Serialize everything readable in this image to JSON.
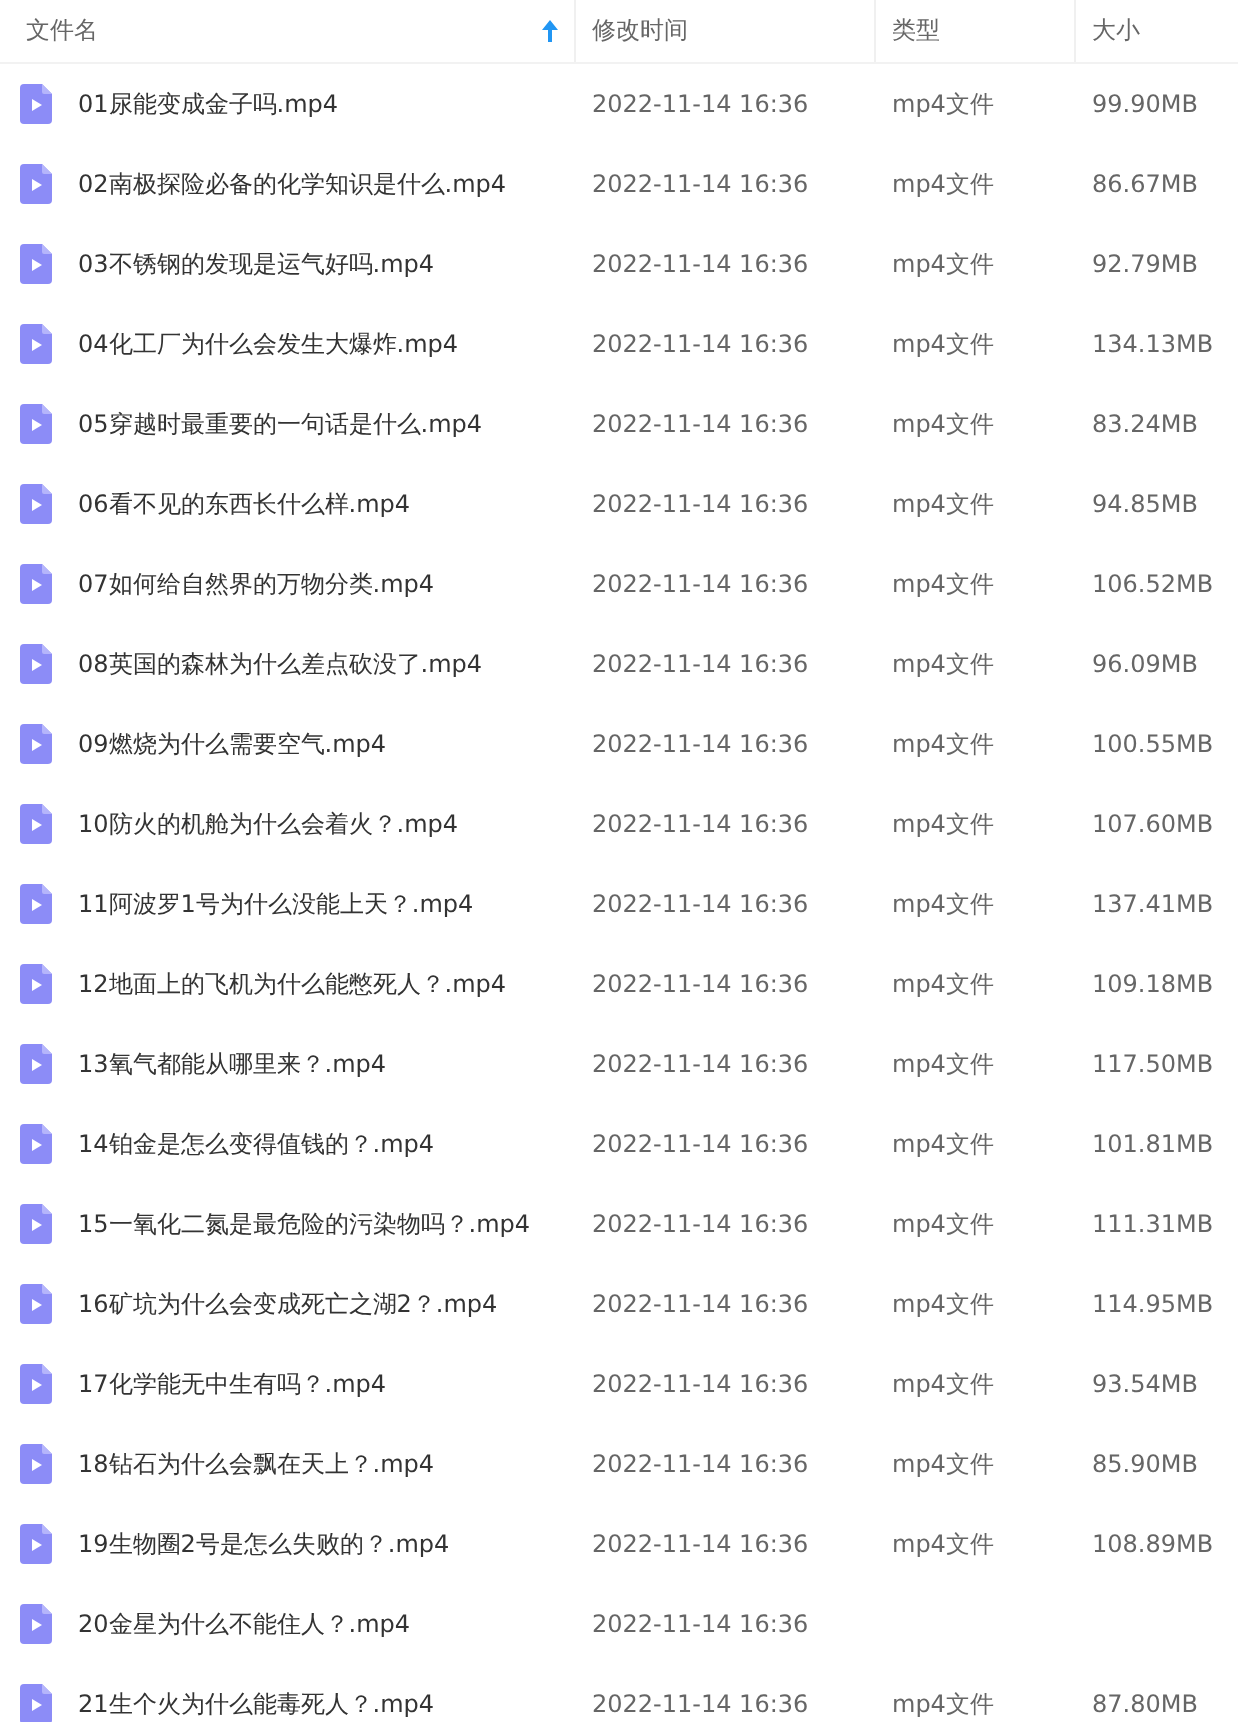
{
  "columns": [
    {
      "label": "文件名",
      "sorted": true
    },
    {
      "label": "修改时间",
      "sorted": false
    },
    {
      "label": "类型",
      "sorted": false
    },
    {
      "label": "大小",
      "sorted": false
    }
  ],
  "rows": [
    {
      "name": "01尿能变成金子吗.mp4",
      "modified": "2022-11-14 16:36",
      "type": "mp4文件",
      "size": "99.90MB"
    },
    {
      "name": "02南极探险必备的化学知识是什么.mp4",
      "modified": "2022-11-14 16:36",
      "type": "mp4文件",
      "size": "86.67MB"
    },
    {
      "name": "03不锈钢的发现是运气好吗.mp4",
      "modified": "2022-11-14 16:36",
      "type": "mp4文件",
      "size": "92.79MB"
    },
    {
      "name": "04化工厂为什么会发生大爆炸.mp4",
      "modified": "2022-11-14 16:36",
      "type": "mp4文件",
      "size": "134.13MB"
    },
    {
      "name": "05穿越时最重要的一句话是什么.mp4",
      "modified": "2022-11-14 16:36",
      "type": "mp4文件",
      "size": "83.24MB"
    },
    {
      "name": "06看不见的东西长什么样.mp4",
      "modified": "2022-11-14 16:36",
      "type": "mp4文件",
      "size": "94.85MB"
    },
    {
      "name": "07如何给自然界的万物分类.mp4",
      "modified": "2022-11-14 16:36",
      "type": "mp4文件",
      "size": "106.52MB"
    },
    {
      "name": "08英国的森林为什么差点砍没了.mp4",
      "modified": "2022-11-14 16:36",
      "type": "mp4文件",
      "size": "96.09MB"
    },
    {
      "name": "09燃烧为什么需要空气.mp4",
      "modified": "2022-11-14 16:36",
      "type": "mp4文件",
      "size": "100.55MB"
    },
    {
      "name": "10防火的机舱为什么会着火？.mp4",
      "modified": "2022-11-14 16:36",
      "type": "mp4文件",
      "size": "107.60MB"
    },
    {
      "name": "11阿波罗1号为什么没能上天？.mp4",
      "modified": "2022-11-14 16:36",
      "type": "mp4文件",
      "size": "137.41MB"
    },
    {
      "name": "12地面上的飞机为什么能憋死人？.mp4",
      "modified": "2022-11-14 16:36",
      "type": "mp4文件",
      "size": "109.18MB"
    },
    {
      "name": "13氧气都能从哪里来？.mp4",
      "modified": "2022-11-14 16:36",
      "type": "mp4文件",
      "size": "117.50MB"
    },
    {
      "name": "14铂金是怎么变得值钱的？.mp4",
      "modified": "2022-11-14 16:36",
      "type": "mp4文件",
      "size": "101.81MB"
    },
    {
      "name": "15一氧化二氮是最危险的污染物吗？.mp4",
      "modified": "2022-11-14 16:36",
      "type": "mp4文件",
      "size": "111.31MB"
    },
    {
      "name": "16矿坑为什么会变成死亡之湖2？.mp4",
      "modified": "2022-11-14 16:36",
      "type": "mp4文件",
      "size": "114.95MB"
    },
    {
      "name": "17化学能无中生有吗？.mp4",
      "modified": "2022-11-14 16:36",
      "type": "mp4文件",
      "size": "93.54MB"
    },
    {
      "name": "18钻石为什么会飘在天上？.mp4",
      "modified": "2022-11-14 16:36",
      "type": "mp4文件",
      "size": "85.90MB"
    },
    {
      "name": "19生物圈2号是怎么失败的？.mp4",
      "modified": "2022-11-14 16:36",
      "type": "mp4文件",
      "size": "108.89MB"
    },
    {
      "name": "20金星为什么不能住人？.mp4",
      "modified": "2022-11-14 16:36"
    },
    {
      "name": "21生个火为什么能毒死人？.mp4",
      "modified": "2022-11-14 16:36",
      "type": "mp4文件",
      "size": "87.80MB"
    }
  ]
}
